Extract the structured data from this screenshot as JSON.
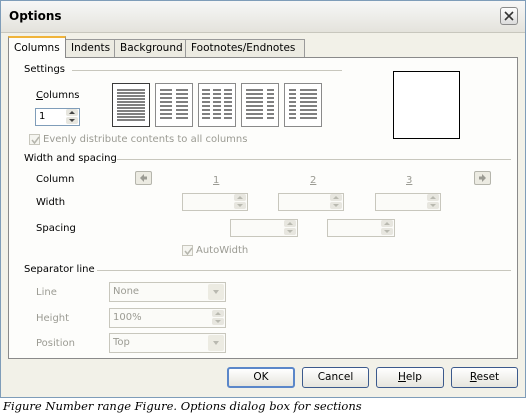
{
  "window": {
    "title": "Options"
  },
  "tabs": [
    {
      "label": "Columns",
      "active": true
    },
    {
      "label": "Indents",
      "active": false
    },
    {
      "label": "Background",
      "active": false
    },
    {
      "label": "Footnotes/Endnotes",
      "active": false
    }
  ],
  "settings": {
    "heading": "Settings",
    "columns_label": "Columns",
    "columns_value": "1",
    "presets": [
      {
        "icon": "single-column-preset-icon",
        "columns": 1,
        "selected": true
      },
      {
        "icon": "two-column-preset-icon",
        "columns": 2,
        "selected": false
      },
      {
        "icon": "three-column-preset-icon",
        "columns": 3,
        "selected": false
      },
      {
        "icon": "two-column-left-wide-preset-icon",
        "columns": 2,
        "selected": false
      },
      {
        "icon": "two-column-right-wide-preset-icon",
        "columns": 2,
        "selected": false
      }
    ],
    "distribute_label": "Evenly distribute contents to all columns",
    "distribute_checked": true
  },
  "width_spacing": {
    "heading": "Width and spacing",
    "column_label": "Column",
    "width_label": "Width",
    "spacing_label": "Spacing",
    "column_numbers": [
      "1",
      "2",
      "3"
    ],
    "autowidth_label": "AutoWidth",
    "autowidth_checked": true
  },
  "separator": {
    "heading": "Separator line",
    "line_label": "Line",
    "line_value": "None",
    "height_label": "Height",
    "height_value": "100%",
    "position_label": "Position",
    "position_value": "Top"
  },
  "buttons": {
    "ok": "OK",
    "cancel": "Cancel",
    "help": "Help",
    "reset": "Reset"
  },
  "caption": "Figure Number range Figure. Options dialog box for sections"
}
